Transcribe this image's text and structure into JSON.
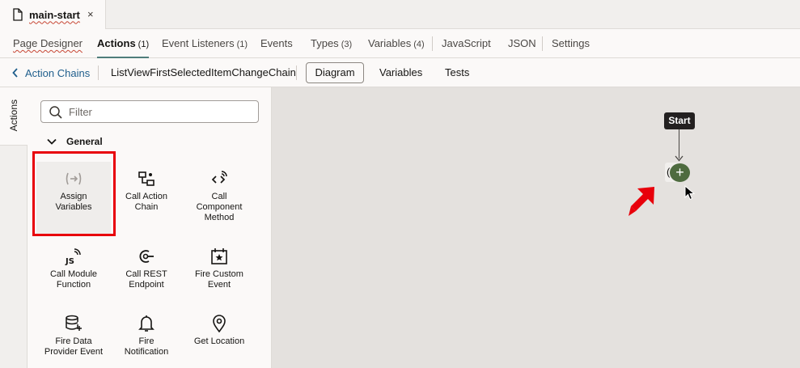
{
  "file_tab": {
    "title": "main-start",
    "close": "×"
  },
  "main_tabs": [
    {
      "label": "Page Designer",
      "count": ""
    },
    {
      "label": "Actions",
      "count": "(1)"
    },
    {
      "label": "Event Listeners",
      "count": "(1)"
    },
    {
      "label": "Events",
      "count": ""
    },
    {
      "label": "Types",
      "count": "(3)"
    },
    {
      "label": "Variables",
      "count": "(4)"
    },
    {
      "label": "JavaScript",
      "count": ""
    },
    {
      "label": "JSON",
      "count": ""
    },
    {
      "label": "Settings",
      "count": ""
    }
  ],
  "sub_bar": {
    "back_label": "Action Chains",
    "chain_name": "ListViewFirstSelectedItemChangeChain",
    "diagram": "Diagram",
    "variables": "Variables",
    "tests": "Tests"
  },
  "rail": {
    "actions": "Actions"
  },
  "palette": {
    "filter_placeholder": "Filter",
    "section": "General",
    "items": [
      {
        "line1": "Assign",
        "line2": "Variables",
        "line3": "",
        "icon": "assign-variables-icon"
      },
      {
        "line1": "Call Action",
        "line2": "Chain",
        "line3": "",
        "icon": "call-action-chain-icon"
      },
      {
        "line1": "Call",
        "line2": "Component",
        "line3": "Method",
        "icon": "call-component-method-icon"
      },
      {
        "line1": "Call Module",
        "line2": "Function",
        "line3": "",
        "icon": "call-module-function-icon"
      },
      {
        "line1": "Call REST",
        "line2": "Endpoint",
        "line3": "",
        "icon": "call-rest-endpoint-icon"
      },
      {
        "line1": "Fire Custom",
        "line2": "Event",
        "line3": "",
        "icon": "fire-custom-event-icon"
      },
      {
        "line1": "Fire Data",
        "line2": "Provider Event",
        "line3": "",
        "icon": "fire-data-provider-event-icon"
      },
      {
        "line1": "Fire",
        "line2": "Notification",
        "line3": "",
        "icon": "fire-notification-icon"
      },
      {
        "line1": "Get Location",
        "line2": "",
        "line3": "",
        "icon": "get-location-icon"
      }
    ]
  },
  "canvas": {
    "start_label": "Start",
    "ghost_text": "(→",
    "add_symbol": "+"
  },
  "colors": {
    "accent": "#4f7d7b",
    "link": "#1f5e8c",
    "add_node": "#4e6b3f",
    "highlight": "#e8000b",
    "arrow": "#e8000b"
  }
}
